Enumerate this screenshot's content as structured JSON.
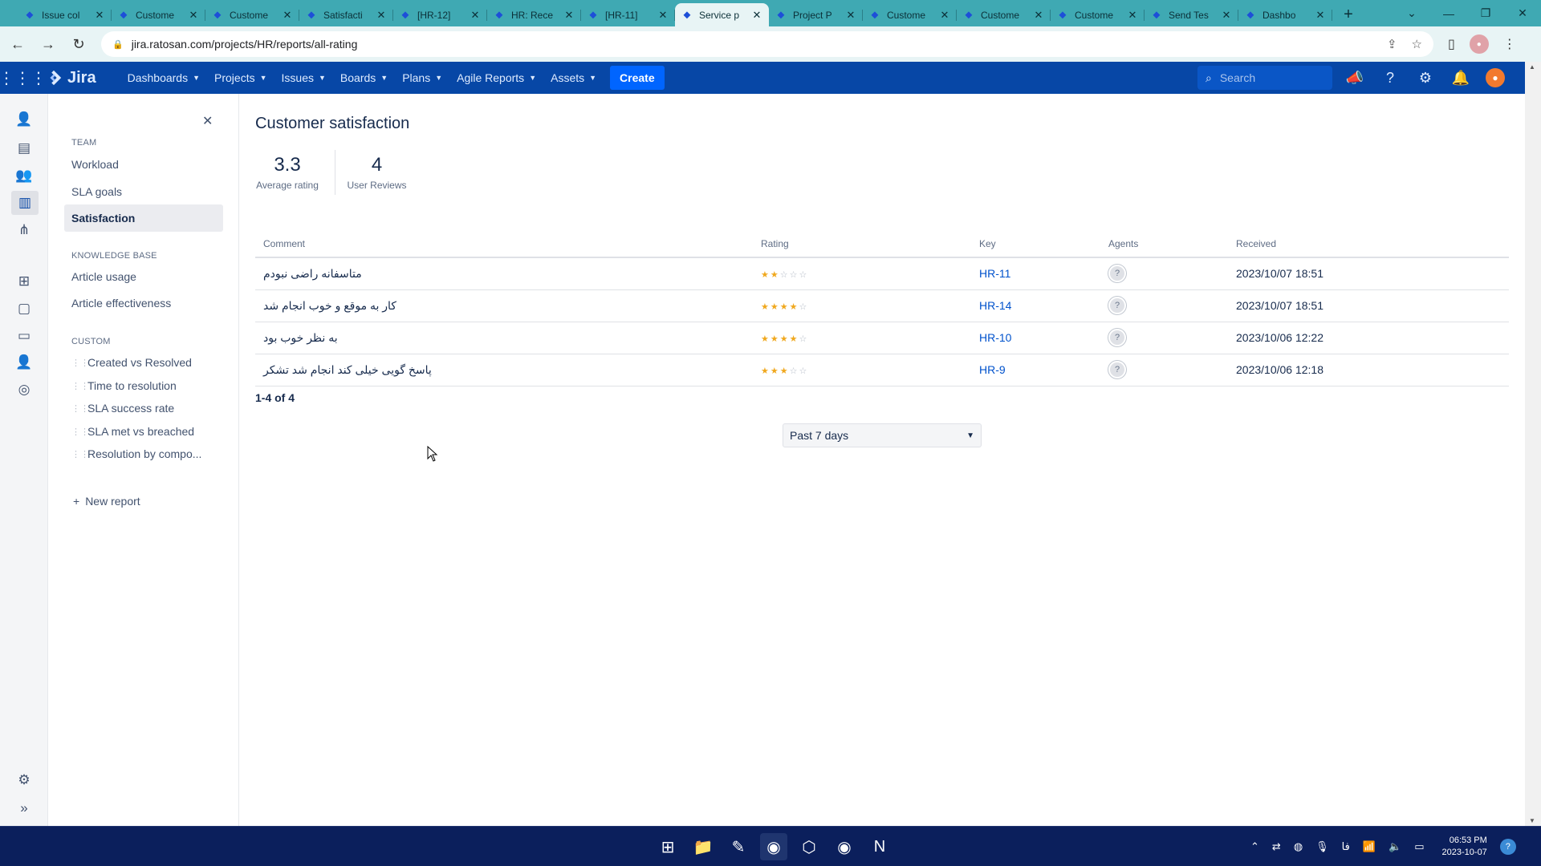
{
  "browser": {
    "tabs": [
      {
        "title": "Issue col"
      },
      {
        "title": "Custome"
      },
      {
        "title": "Custome"
      },
      {
        "title": "Satisfacti"
      },
      {
        "title": "[HR-12]"
      },
      {
        "title": "HR: Rece"
      },
      {
        "title": "[HR-11]"
      },
      {
        "title": "Service p"
      },
      {
        "title": "Project P"
      },
      {
        "title": "Custome"
      },
      {
        "title": "Custome"
      },
      {
        "title": "Custome"
      },
      {
        "title": "Send Tes"
      },
      {
        "title": "Dashbo"
      }
    ],
    "active_tab_index": 7,
    "url": "jira.ratosan.com/projects/HR/reports/all-rating"
  },
  "jira_nav": {
    "logo": "Jira",
    "menu": [
      "Dashboards",
      "Projects",
      "Issues",
      "Boards",
      "Plans",
      "Agile Reports",
      "Assets"
    ],
    "create_label": "Create",
    "search_placeholder": "Search"
  },
  "sidebar": {
    "team_header": "TEAM",
    "team_items": [
      "Workload",
      "SLA goals",
      "Satisfaction"
    ],
    "active_item": "Satisfaction",
    "kb_header": "KNOWLEDGE BASE",
    "kb_items": [
      "Article usage",
      "Article effectiveness"
    ],
    "custom_header": "CUSTOM",
    "custom_items": [
      "Created vs Resolved",
      "Time to resolution",
      "SLA success rate",
      "SLA met vs breached",
      "Resolution by compo..."
    ],
    "new_report_label": "New report"
  },
  "main": {
    "title": "Customer satisfaction",
    "stats": [
      {
        "value": "3.3",
        "label": "Average rating"
      },
      {
        "value": "4",
        "label": "User Reviews"
      }
    ],
    "columns": [
      "Comment",
      "Rating",
      "Key",
      "Agents",
      "Received"
    ],
    "rows": [
      {
        "comment": "متاسفانه راضی نبودم",
        "rating": 2,
        "key": "HR-11",
        "received": "2023/10/07 18:51"
      },
      {
        "comment": "کار به موقع و خوب انجام شد",
        "rating": 4,
        "key": "HR-14",
        "received": "2023/10/07 18:51"
      },
      {
        "comment": "به نظر خوب بود",
        "rating": 4,
        "key": "HR-10",
        "received": "2023/10/06 12:22"
      },
      {
        "comment": "پاسخ گویی خیلی کند انجام شد تشکر",
        "rating": 3,
        "key": "HR-9",
        "received": "2023/10/06 12:18"
      }
    ],
    "rating_max": 5,
    "pagination": "1-4 of 4",
    "period_select": "Past 7 days"
  },
  "taskbar": {
    "time": "06:53 PM",
    "date": "2023-10-07",
    "lang": "فا"
  },
  "colors": {
    "jira_nav": "#0747a6",
    "tabstrip": "#3fa9b3",
    "link": "#0052cc",
    "star": "#f0a81e",
    "taskbar": "#0b1f5c"
  }
}
